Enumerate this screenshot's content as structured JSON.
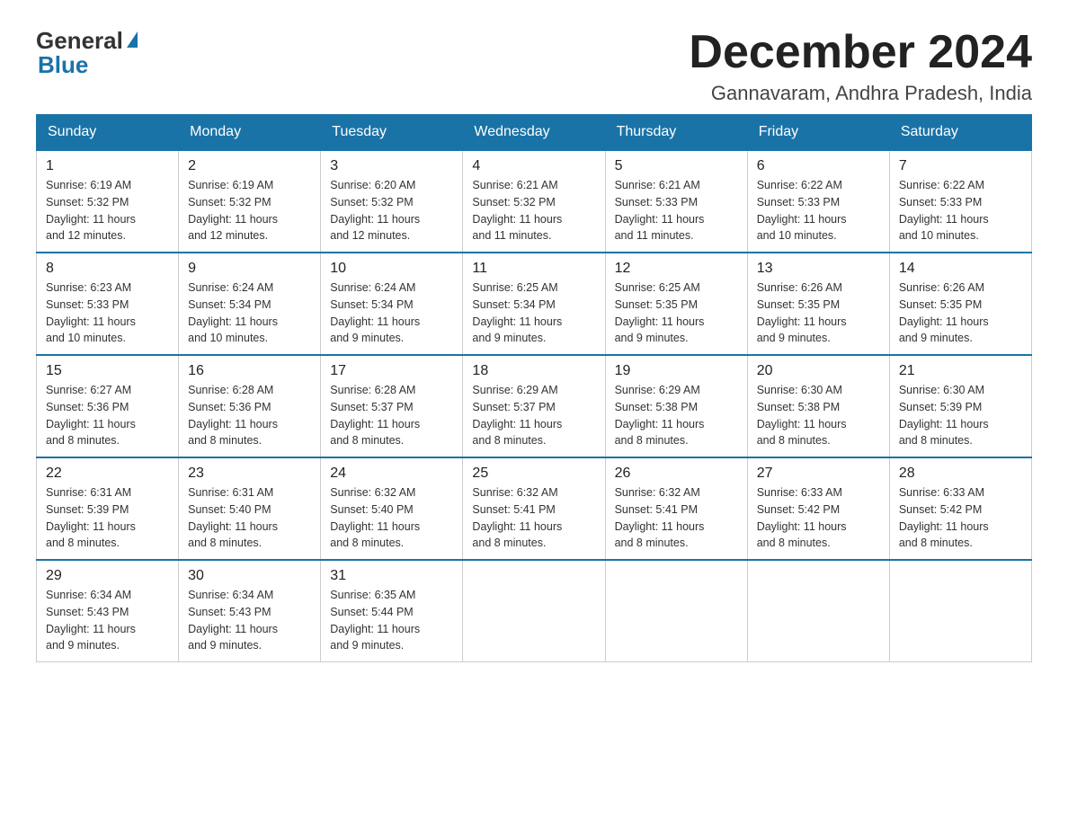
{
  "logo": {
    "general": "General",
    "blue": "Blue"
  },
  "title": "December 2024",
  "subtitle": "Gannavaram, Andhra Pradesh, India",
  "days_of_week": [
    "Sunday",
    "Monday",
    "Tuesday",
    "Wednesday",
    "Thursday",
    "Friday",
    "Saturday"
  ],
  "weeks": [
    [
      {
        "day": "1",
        "sunrise": "6:19 AM",
        "sunset": "5:32 PM",
        "daylight": "11 hours and 12 minutes."
      },
      {
        "day": "2",
        "sunrise": "6:19 AM",
        "sunset": "5:32 PM",
        "daylight": "11 hours and 12 minutes."
      },
      {
        "day": "3",
        "sunrise": "6:20 AM",
        "sunset": "5:32 PM",
        "daylight": "11 hours and 12 minutes."
      },
      {
        "day": "4",
        "sunrise": "6:21 AM",
        "sunset": "5:32 PM",
        "daylight": "11 hours and 11 minutes."
      },
      {
        "day": "5",
        "sunrise": "6:21 AM",
        "sunset": "5:33 PM",
        "daylight": "11 hours and 11 minutes."
      },
      {
        "day": "6",
        "sunrise": "6:22 AM",
        "sunset": "5:33 PM",
        "daylight": "11 hours and 10 minutes."
      },
      {
        "day": "7",
        "sunrise": "6:22 AM",
        "sunset": "5:33 PM",
        "daylight": "11 hours and 10 minutes."
      }
    ],
    [
      {
        "day": "8",
        "sunrise": "6:23 AM",
        "sunset": "5:33 PM",
        "daylight": "11 hours and 10 minutes."
      },
      {
        "day": "9",
        "sunrise": "6:24 AM",
        "sunset": "5:34 PM",
        "daylight": "11 hours and 10 minutes."
      },
      {
        "day": "10",
        "sunrise": "6:24 AM",
        "sunset": "5:34 PM",
        "daylight": "11 hours and 9 minutes."
      },
      {
        "day": "11",
        "sunrise": "6:25 AM",
        "sunset": "5:34 PM",
        "daylight": "11 hours and 9 minutes."
      },
      {
        "day": "12",
        "sunrise": "6:25 AM",
        "sunset": "5:35 PM",
        "daylight": "11 hours and 9 minutes."
      },
      {
        "day": "13",
        "sunrise": "6:26 AM",
        "sunset": "5:35 PM",
        "daylight": "11 hours and 9 minutes."
      },
      {
        "day": "14",
        "sunrise": "6:26 AM",
        "sunset": "5:35 PM",
        "daylight": "11 hours and 9 minutes."
      }
    ],
    [
      {
        "day": "15",
        "sunrise": "6:27 AM",
        "sunset": "5:36 PM",
        "daylight": "11 hours and 8 minutes."
      },
      {
        "day": "16",
        "sunrise": "6:28 AM",
        "sunset": "5:36 PM",
        "daylight": "11 hours and 8 minutes."
      },
      {
        "day": "17",
        "sunrise": "6:28 AM",
        "sunset": "5:37 PM",
        "daylight": "11 hours and 8 minutes."
      },
      {
        "day": "18",
        "sunrise": "6:29 AM",
        "sunset": "5:37 PM",
        "daylight": "11 hours and 8 minutes."
      },
      {
        "day": "19",
        "sunrise": "6:29 AM",
        "sunset": "5:38 PM",
        "daylight": "11 hours and 8 minutes."
      },
      {
        "day": "20",
        "sunrise": "6:30 AM",
        "sunset": "5:38 PM",
        "daylight": "11 hours and 8 minutes."
      },
      {
        "day": "21",
        "sunrise": "6:30 AM",
        "sunset": "5:39 PM",
        "daylight": "11 hours and 8 minutes."
      }
    ],
    [
      {
        "day": "22",
        "sunrise": "6:31 AM",
        "sunset": "5:39 PM",
        "daylight": "11 hours and 8 minutes."
      },
      {
        "day": "23",
        "sunrise": "6:31 AM",
        "sunset": "5:40 PM",
        "daylight": "11 hours and 8 minutes."
      },
      {
        "day": "24",
        "sunrise": "6:32 AM",
        "sunset": "5:40 PM",
        "daylight": "11 hours and 8 minutes."
      },
      {
        "day": "25",
        "sunrise": "6:32 AM",
        "sunset": "5:41 PM",
        "daylight": "11 hours and 8 minutes."
      },
      {
        "day": "26",
        "sunrise": "6:32 AM",
        "sunset": "5:41 PM",
        "daylight": "11 hours and 8 minutes."
      },
      {
        "day": "27",
        "sunrise": "6:33 AM",
        "sunset": "5:42 PM",
        "daylight": "11 hours and 8 minutes."
      },
      {
        "day": "28",
        "sunrise": "6:33 AM",
        "sunset": "5:42 PM",
        "daylight": "11 hours and 8 minutes."
      }
    ],
    [
      {
        "day": "29",
        "sunrise": "6:34 AM",
        "sunset": "5:43 PM",
        "daylight": "11 hours and 9 minutes."
      },
      {
        "day": "30",
        "sunrise": "6:34 AM",
        "sunset": "5:43 PM",
        "daylight": "11 hours and 9 minutes."
      },
      {
        "day": "31",
        "sunrise": "6:35 AM",
        "sunset": "5:44 PM",
        "daylight": "11 hours and 9 minutes."
      },
      null,
      null,
      null,
      null
    ]
  ],
  "sunrise_label": "Sunrise:",
  "sunset_label": "Sunset:",
  "daylight_label": "Daylight:"
}
